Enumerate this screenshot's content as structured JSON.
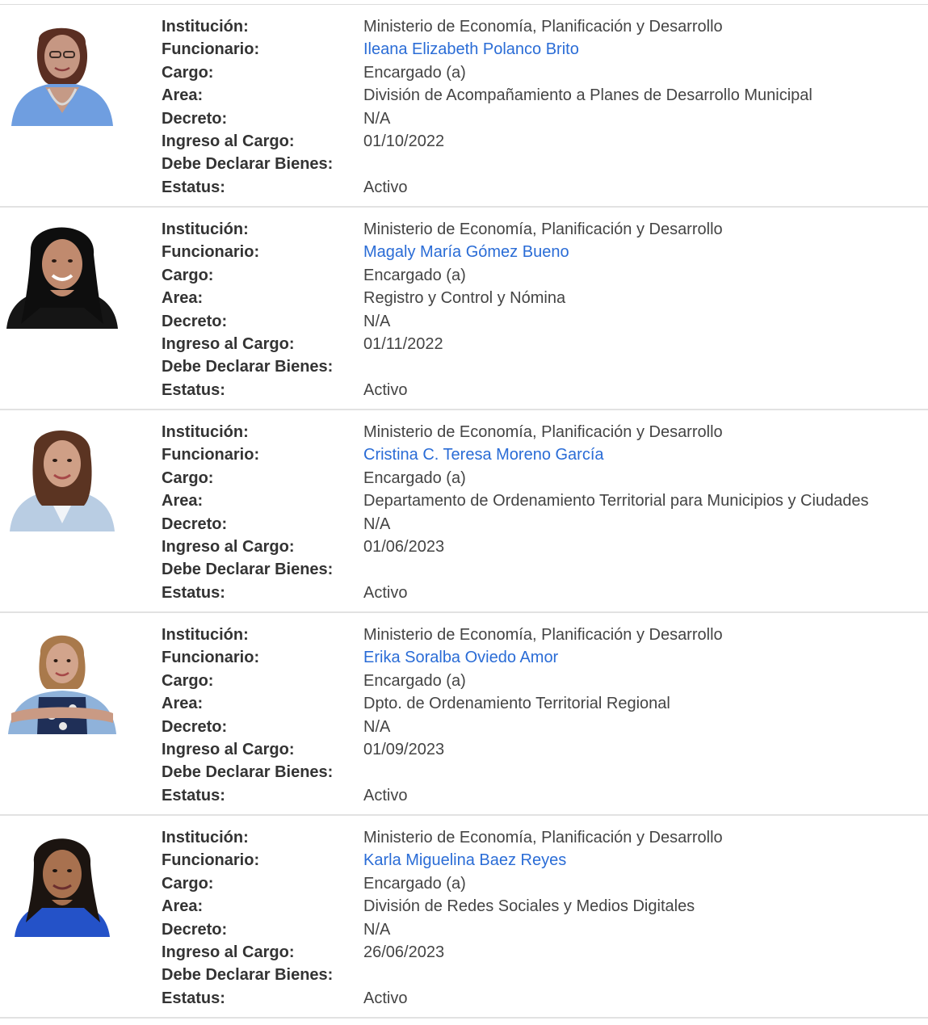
{
  "labels": {
    "institucion": "Institución:",
    "funcionario": "Funcionario:",
    "cargo": "Cargo:",
    "area": "Area:",
    "decreto": "Decreto:",
    "ingreso": "Ingreso al Cargo:",
    "declarar": "Debe Declarar Bienes:",
    "estatus": "Estatus:"
  },
  "colors": {
    "link": "#2a6cd6",
    "label": "#333333",
    "divider": "#e2e2e2"
  },
  "records": [
    {
      "institucion": "Ministerio de Economía, Planificación y Desarrollo",
      "funcionario": "Ileana Elizabeth Polanco Brito",
      "cargo": "Encargado (a)",
      "area": "División de Acompañamiento a Planes de Desarrollo Municipal",
      "decreto": "N/A",
      "ingreso": "01/10/2022",
      "declarar": "",
      "estatus": "Activo"
    },
    {
      "institucion": "Ministerio de Economía, Planificación y Desarrollo",
      "funcionario": "Magaly María Gómez Bueno",
      "cargo": "Encargado (a)",
      "area": "Registro y Control y Nómina",
      "decreto": "N/A",
      "ingreso": "01/11/2022",
      "declarar": "",
      "estatus": "Activo"
    },
    {
      "institucion": "Ministerio de Economía, Planificación y Desarrollo",
      "funcionario": "Cristina C. Teresa Moreno García",
      "cargo": "Encargado (a)",
      "area": "Departamento de Ordenamiento Territorial para Municipios y Ciudades",
      "decreto": "N/A",
      "ingreso": "01/06/2023",
      "declarar": "",
      "estatus": "Activo"
    },
    {
      "institucion": "Ministerio de Economía, Planificación y Desarrollo",
      "funcionario": "Erika Soralba Oviedo Amor",
      "cargo": "Encargado (a)",
      "area": "Dpto. de Ordenamiento Territorial Regional",
      "decreto": "N/A",
      "ingreso": "01/09/2023",
      "declarar": "",
      "estatus": "Activo"
    },
    {
      "institucion": "Ministerio de Economía, Planificación y Desarrollo",
      "funcionario": "Karla Miguelina Baez Reyes",
      "cargo": "Encargado (a)",
      "area": "División de Redes Sociales y Medios Digitales",
      "decreto": "N/A",
      "ingreso": "26/06/2023",
      "declarar": "",
      "estatus": "Activo"
    }
  ]
}
